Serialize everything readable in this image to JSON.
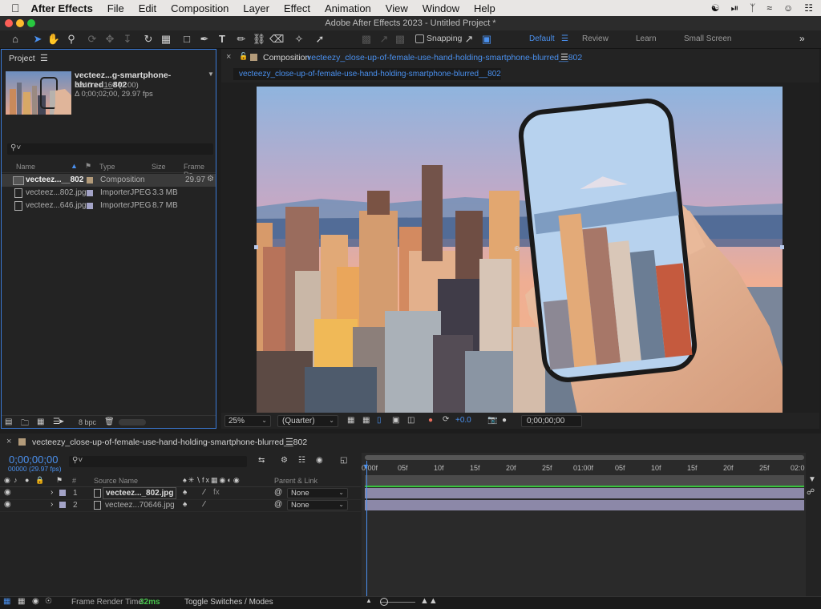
{
  "menubar": {
    "app_name": "After Effects",
    "items": [
      "File",
      "Edit",
      "Composition",
      "Layer",
      "Effect",
      "Animation",
      "View",
      "Window",
      "Help"
    ]
  },
  "window": {
    "title": "Adobe After Effects 2023 - Untitled Project *"
  },
  "toolbar": {
    "snapping_label": "Snapping",
    "workspaces": [
      "Default",
      "Review",
      "Learn",
      "Small Screen"
    ],
    "active_workspace": "Default"
  },
  "project": {
    "tab_label": "Project",
    "selected_name": "vecteez...g-smartphone-blurred__802",
    "selected_dims": "6240 x 4160 (1.00)",
    "selected_duration": "Δ 0;00;02;00, 29.97 fps",
    "columns": {
      "name": "Name",
      "type": "Type",
      "size": "Size",
      "frame_rate": "Frame Ra..."
    },
    "items": [
      {
        "name": "vecteez...__802",
        "type": "Composition",
        "size": "",
        "frame_rate": "29.97",
        "color": "#b39b7a"
      },
      {
        "name": "vecteez...802.jpg",
        "type": "ImporterJPEG",
        "size": "3.3 MB",
        "frame_rate": "",
        "color": "#a3a3c7"
      },
      {
        "name": "vecteez...646.jpg",
        "type": "ImporterJPEG",
        "size": "8.7 MB",
        "frame_rate": "",
        "color": "#a3a3c7"
      }
    ],
    "bpc_label": "8 bpc"
  },
  "composition": {
    "tab_prefix": "Composition",
    "tab_name": "vecteezy_close-up-of-female-use-hand-holding-smartphone-blurred__802",
    "sub_tab": "vecteezy_close-up-of-female-use-hand-holding-smartphone-blurred__802",
    "zoom": "25%",
    "resolution": "(Quarter)",
    "exposure": "+0.0",
    "timecode": "0;00;00;00"
  },
  "timeline": {
    "tab_name": "vecteezy_close-up-of-female-use-hand-holding-smartphone-blurred__802",
    "current_time": "0;00;00;00",
    "frame_info": "00000 (29.97 fps)",
    "columns": {
      "source_name": "Source Name",
      "parent_link": "Parent & Link",
      "num": "#"
    },
    "ruler_labels": [
      "0:00f",
      "05f",
      "10f",
      "15f",
      "20f",
      "25f",
      "01:00f",
      "05f",
      "10f",
      "15f",
      "20f",
      "25f",
      "02:0"
    ],
    "layers": [
      {
        "num": "1",
        "name": "vecteez..._802.jpg",
        "parent": "None",
        "color": "#a3a3c7"
      },
      {
        "num": "2",
        "name": "vecteez...70646.jpg",
        "parent": "None",
        "color": "#a3a3c7"
      }
    ]
  },
  "statusbar": {
    "render_label": "Frame Render Time",
    "render_value": "32ms",
    "toggle_label": "Toggle Switches / Modes"
  }
}
